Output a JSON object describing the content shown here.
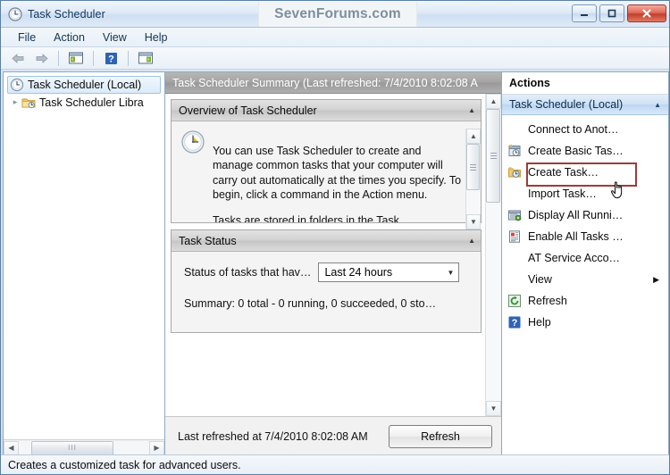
{
  "window": {
    "title": "Task Scheduler",
    "icon": "clock-icon",
    "watermark": "SevenForums.com",
    "controls": {
      "minimize": "minimize-button",
      "maximize": "maximize-button",
      "close": "close-button"
    }
  },
  "menubar": {
    "items": [
      {
        "label": "File"
      },
      {
        "label": "Action"
      },
      {
        "label": "View"
      },
      {
        "label": "Help"
      }
    ]
  },
  "toolbar": {
    "buttons": [
      {
        "name": "back-arrow-icon"
      },
      {
        "name": "forward-arrow-icon"
      },
      {
        "name": "show-hide-console-tree-icon"
      },
      {
        "name": "help-icon"
      },
      {
        "name": "show-hide-action-pane-icon"
      }
    ]
  },
  "tree": {
    "items": [
      {
        "label": "Task Scheduler (Local)",
        "icon": "clock-icon",
        "selected": true,
        "expander": ""
      },
      {
        "label": "Task Scheduler Libra",
        "icon": "folder-clock-icon",
        "selected": false,
        "expander": "▸"
      }
    ],
    "hscroll": {
      "left_arrow": "◀",
      "right_arrow": "▶",
      "thumb_grip": "III"
    }
  },
  "main": {
    "header": "Task Scheduler Summary (Last refreshed: 7/4/2010 8:02:08 A",
    "overview": {
      "title": "Overview of Task Scheduler",
      "collapse_caret": "▲",
      "icon": "clock-icon",
      "paragraph1": "You can use Task Scheduler to create and manage common tasks that your computer will carry out automatically at the times you specify. To begin, click a command in the Action menu.",
      "paragraph2": "Tasks are stored in folders in the Task"
    },
    "task_status": {
      "title": "Task Status",
      "collapse_caret": "▲",
      "filter_label": "Status of tasks that hav…",
      "filter_value": "Last 24 hours",
      "filter_arrow": "▼",
      "summary": "Summary: 0 total - 0 running, 0 succeeded, 0 sto…"
    },
    "footer": {
      "last_refreshed": "Last refreshed at 7/4/2010 8:02:08 AM",
      "refresh_button": "Refresh"
    },
    "scrollbar": {
      "up_arrow": "▲",
      "down_arrow": "▼"
    }
  },
  "actions": {
    "title": "Actions",
    "group": {
      "label": "Task Scheduler (Local)",
      "collapse_caret": "▲"
    },
    "items": [
      {
        "label": "Connect to Anot…",
        "icon": "",
        "highlighted": false
      },
      {
        "label": "Create Basic Tas…",
        "icon": "create-basic-task-icon",
        "highlighted": false
      },
      {
        "label": "Create Task…",
        "icon": "create-task-icon",
        "highlighted": true
      },
      {
        "label": "Import Task…",
        "icon": "",
        "highlighted": false
      },
      {
        "label": "Display All Runni…",
        "icon": "display-running-tasks-icon",
        "highlighted": false
      },
      {
        "label": "Enable All Tasks …",
        "icon": "enable-all-tasks-icon",
        "highlighted": false
      },
      {
        "label": "AT Service Acco…",
        "icon": "",
        "highlighted": false
      },
      {
        "label": "View",
        "icon": "",
        "highlighted": false,
        "submenu_arrow": "▶"
      },
      {
        "label": "Refresh",
        "icon": "refresh-icon",
        "highlighted": false
      },
      {
        "label": "Help",
        "icon": "help-icon",
        "highlighted": false
      }
    ]
  },
  "statusbar": {
    "text": "Creates a customized task for advanced users."
  },
  "cursor": {
    "type": "hand-pointer"
  },
  "colors": {
    "highlight_border": "#a03a3a",
    "header_gray": "#a3a3a3",
    "actions_group_blue": "#cfe2f6",
    "close_button_red": "#c33f2c"
  }
}
